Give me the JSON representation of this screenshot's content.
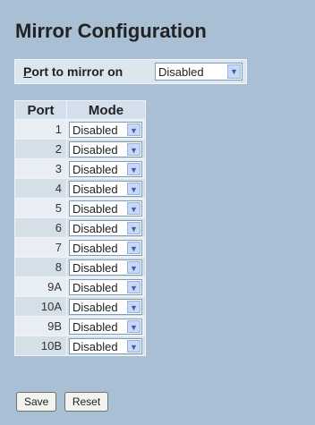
{
  "page": {
    "title": "Mirror Configuration"
  },
  "mirror": {
    "label_underlined": "P",
    "label_rest": "ort to mirror on",
    "selected": "Disabled"
  },
  "table": {
    "headers": [
      "Port",
      "Mode"
    ],
    "rows": [
      {
        "port": "1",
        "mode": "Disabled"
      },
      {
        "port": "2",
        "mode": "Disabled"
      },
      {
        "port": "3",
        "mode": "Disabled"
      },
      {
        "port": "4",
        "mode": "Disabled"
      },
      {
        "port": "5",
        "mode": "Disabled"
      },
      {
        "port": "6",
        "mode": "Disabled"
      },
      {
        "port": "7",
        "mode": "Disabled"
      },
      {
        "port": "8",
        "mode": "Disabled"
      },
      {
        "port": "9A",
        "mode": "Disabled"
      },
      {
        "port": "10A",
        "mode": "Disabled"
      },
      {
        "port": "9B",
        "mode": "Disabled"
      },
      {
        "port": "10B",
        "mode": "Disabled"
      }
    ]
  },
  "buttons": {
    "save": "Save",
    "reset": "Reset"
  },
  "icons": {
    "dropdown": "chevron-down-icon"
  }
}
